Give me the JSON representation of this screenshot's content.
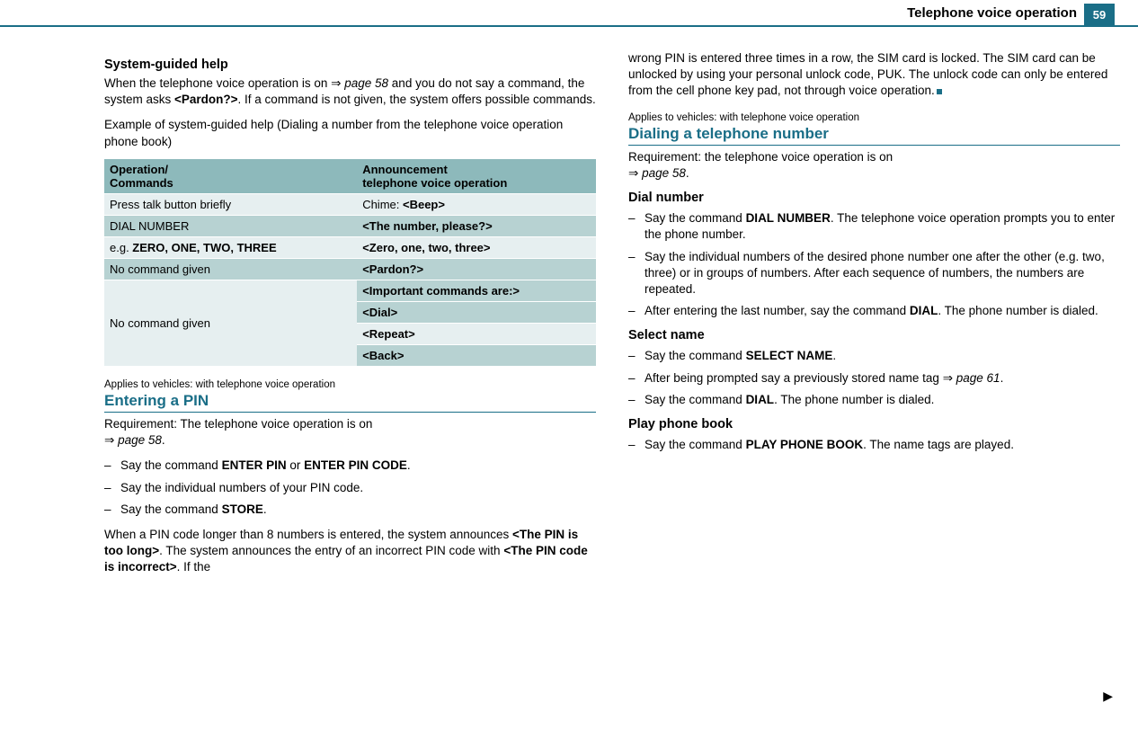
{
  "header": {
    "title": "Telephone voice operation",
    "page_number": "59"
  },
  "left": {
    "h1": "System-guided help",
    "p1a": "When the telephone voice operation is on ",
    "p1_arrow": "⇒",
    "p1_pageref": " page 58",
    "p1b": " and you do not say a command, the system asks ",
    "p1_bold": "<Pardon?>",
    "p1c": ". If a command is not given, the system offers possible commands.",
    "p2": "Example of system-guided help (Dialing a number from the tele­phone voice operation phone book)",
    "table": {
      "th1a": "Operation/",
      "th1b": "Commands",
      "th2a": "Announcement",
      "th2b": "telephone voice operation",
      "r1c1": "Press talk button briefly",
      "r1c2a": "Chime: ",
      "r1c2b": "<Beep>",
      "r2c1": "DIAL NUMBER",
      "r2c2": "<The number, please?>",
      "r3c1a": "e.g. ",
      "r3c1b": "ZERO, ONE, TWO, THREE",
      "r3c2": "<Zero, one, two, three>",
      "r4c1": "No command given",
      "r4c2": "<Pardon?>",
      "r5c1": "No command given",
      "r5c2": "<Important commands are:>",
      "r6c2": "<Dial>",
      "r7c2": "<Repeat>",
      "r8c2": "<Back>"
    },
    "applies1": "Applies to vehicles: with telephone voice operation",
    "h2": "Entering a PIN",
    "p3a": "Requirement: The telephone voice operation is on ",
    "p3_arrow": "⇒",
    "p3_pageref": " page 58",
    "p3b": ".",
    "li1a": "Say the command ",
    "li1b": "ENTER PIN",
    "li1c": " or ",
    "li1d": "ENTER PIN CODE",
    "li1e": ".",
    "li2": "Say the individual numbers of your PIN code.",
    "li3a": "Say the command ",
    "li3b": "STORE",
    "li3c": ".",
    "p4a": "When a PIN code longer than 8 numbers is entered, the system announces ",
    "p4b": "<The PIN is too long>",
    "p4c": ". The system announces the entry of an incorrect PIN code with ",
    "p4d": "<The PIN code is incorrect>",
    "p4e": ". If the"
  },
  "right": {
    "p1": "wrong PIN is entered three times in a row, the SIM card is locked. The SIM card can be unlocked by using your personal unlock code, PUK. The unlock code can only be entered from the cell phone key pad, not through voice operation.",
    "applies": "Applies to vehicles: with telephone voice operation",
    "h2": "Dialing a telephone number",
    "p2a": "Requirement: the telephone voice operation is on ",
    "p2_arrow": "⇒",
    "p2_pageref": " page 58",
    "p2b": ".",
    "h3a": "Dial number",
    "li1a": "Say the command ",
    "li1b": "DIAL NUMBER",
    "li1c": ". The telephone voice operation prompts you to enter the phone number.",
    "li2": "Say the individual numbers of the desired phone number one after the other (e.g. two, three) or in groups of numbers. After each sequence of numbers, the numbers are repeated.",
    "li3a": "After entering the last number, say the command ",
    "li3b": "DIAL",
    "li3c": ". The phone number is dialed.",
    "h3b": "Select name",
    "li4a": "Say the command ",
    "li4b": "SELECT NAME",
    "li4c": ".",
    "li5a": "After being prompted say a previously stored name tag ",
    "li5_arrow": "⇒",
    "li5_pageref": " page 61",
    "li5b": ".",
    "li6a": "Say the command ",
    "li6b": "DIAL",
    "li6c": ". The phone number is dialed.",
    "h3c": "Play phone book",
    "li7a": "Say the command ",
    "li7b": "PLAY PHONE BOOK",
    "li7c": ". The name tags are played."
  },
  "continue": "▶"
}
